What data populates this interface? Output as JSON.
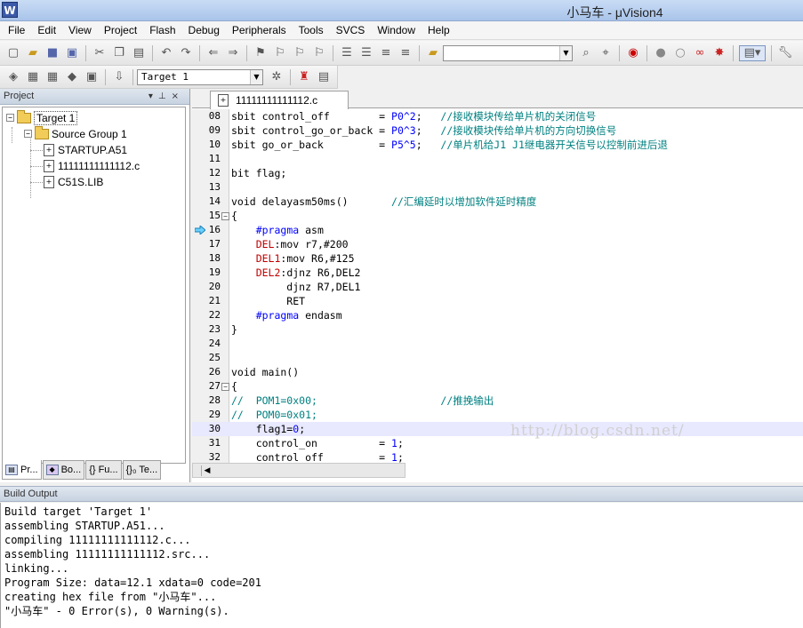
{
  "window": {
    "title": "小马车 - μVision4",
    "icon": "keil-uvision-icon"
  },
  "menu": [
    "File",
    "Edit",
    "View",
    "Project",
    "Flash",
    "Debug",
    "Peripherals",
    "Tools",
    "SVCS",
    "Window",
    "Help"
  ],
  "toolbar": {
    "target_select": "Target 1"
  },
  "project": {
    "title": "Project",
    "tree": [
      {
        "label": "Target 1",
        "type": "target"
      },
      {
        "label": "Source Group 1",
        "type": "group"
      },
      {
        "label": "STARTUP.A51",
        "type": "file"
      },
      {
        "label": "11111111111112.c",
        "type": "file"
      },
      {
        "label": "C51S.LIB",
        "type": "file"
      }
    ],
    "tabs": [
      "Pr...",
      "Bo...",
      "{} Fu...",
      "{}₀ Te..."
    ]
  },
  "editor": {
    "tab_label": "11111111111112.c",
    "watermark": "http://blog.csdn.net/",
    "current_line": "30",
    "lines": [
      {
        "n": "08",
        "code": "sbit control_off        = P0^2;   //接收模块传给单片机的关闭信号"
      },
      {
        "n": "09",
        "code": "sbit control_go_or_back = P0^3;   //接收模块传给单片机的方向切换信号"
      },
      {
        "n": "10",
        "code": "sbit go_or_back         = P5^5;   //单片机给J1 J1继电器开关信号以控制前进后退"
      },
      {
        "n": "11",
        "code": ""
      },
      {
        "n": "12",
        "code": "bit flag;"
      },
      {
        "n": "13",
        "code": ""
      },
      {
        "n": "14",
        "code": "void delayasm50ms()       //汇编延时以增加软件延时精度"
      },
      {
        "n": "15",
        "code": "{"
      },
      {
        "n": "16",
        "code": "    #pragma asm"
      },
      {
        "n": "17",
        "code": "    DEL:mov r7,#200"
      },
      {
        "n": "18",
        "code": "    DEL1:mov R6,#125"
      },
      {
        "n": "19",
        "code": "    DEL2:djnz R6,DEL2"
      },
      {
        "n": "20",
        "code": "         djnz R7,DEL1"
      },
      {
        "n": "21",
        "code": "         RET"
      },
      {
        "n": "22",
        "code": "    #pragma endasm"
      },
      {
        "n": "23",
        "code": "}"
      },
      {
        "n": "24",
        "code": ""
      },
      {
        "n": "25",
        "code": ""
      },
      {
        "n": "26",
        "code": "void main()"
      },
      {
        "n": "27",
        "code": "{"
      },
      {
        "n": "28",
        "code": "//  POM1=0x00;                    //推挽输出"
      },
      {
        "n": "29",
        "code": "//  POM0=0x01;"
      },
      {
        "n": "30",
        "code": "    flag1=0;"
      },
      {
        "n": "31",
        "code": "    control_on          = 1;"
      },
      {
        "n": "32",
        "code": "    control_off         = 1;"
      }
    ]
  },
  "build": {
    "title": "Build Output",
    "lines": [
      "Build target 'Target 1'",
      "assembling STARTUP.A51...",
      "compiling 11111111111112.c...",
      "assembling 11111111111112.src...",
      "linking...",
      "Program Size: data=12.1 xdata=0 code=201",
      "creating hex file from \"小马车\"...",
      "\"小马车\" - 0 Error(s), 0 Warning(s)."
    ]
  }
}
